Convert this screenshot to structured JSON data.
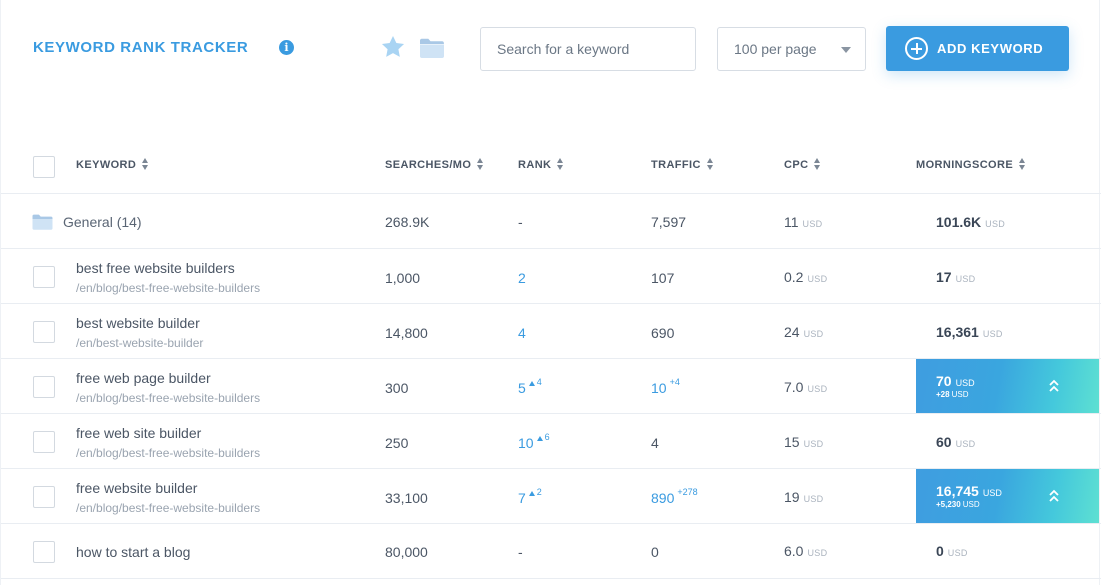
{
  "header": {
    "title": "KEYWORD RANK TRACKER",
    "info_icon": "i",
    "search_placeholder": "Search for a keyword",
    "per_page": "100 per page",
    "add_button": "ADD KEYWORD"
  },
  "columns": {
    "keyword": "KEYWORD",
    "searches": "SEARCHES/MO",
    "rank": "RANK",
    "traffic": "TRAFFIC",
    "cpc": "CPC",
    "morningscore": "MORNINGSCORE"
  },
  "group": {
    "name": "General (14)",
    "searches": "268.9K",
    "rank": "-",
    "traffic": "7,597",
    "cpc": "11",
    "cpc_unit": "USD",
    "score": "101.6K",
    "score_unit": "USD"
  },
  "rows": [
    {
      "keyword": "best free website builders",
      "path": "/en/blog/best-free-website-builders",
      "searches": "1,000",
      "rank": "2",
      "rank_change": "",
      "traffic": "107",
      "traffic_change": "",
      "cpc": "0.2",
      "cpc_unit": "USD",
      "score": "17",
      "score_unit": "USD",
      "score_change": "",
      "highlight": false
    },
    {
      "keyword": "best website builder",
      "path": "/en/best-website-builder",
      "searches": "14,800",
      "rank": "4",
      "rank_change": "",
      "traffic": "690",
      "traffic_change": "",
      "cpc": "24",
      "cpc_unit": "USD",
      "score": "16,361",
      "score_unit": "USD",
      "score_change": "",
      "highlight": false
    },
    {
      "keyword": "free web page builder",
      "path": "/en/blog/best-free-website-builders",
      "searches": "300",
      "rank": "5",
      "rank_change": "4",
      "traffic": "10",
      "traffic_change": "+4",
      "cpc": "7.0",
      "cpc_unit": "USD",
      "score": "70",
      "score_unit": "USD",
      "score_change": "+28",
      "highlight": true
    },
    {
      "keyword": "free web site builder",
      "path": "/en/blog/best-free-website-builders",
      "searches": "250",
      "rank": "10",
      "rank_change": "6",
      "traffic": "4",
      "traffic_change": "",
      "cpc": "15",
      "cpc_unit": "USD",
      "score": "60",
      "score_unit": "USD",
      "score_change": "",
      "highlight": false
    },
    {
      "keyword": "free website builder",
      "path": "/en/blog/best-free-website-builders",
      "searches": "33,100",
      "rank": "7",
      "rank_change": "2",
      "traffic": "890",
      "traffic_change": "+278",
      "cpc": "19",
      "cpc_unit": "USD",
      "score": "16,745",
      "score_unit": "USD",
      "score_change": "+5,230",
      "highlight": true
    },
    {
      "keyword": "how to start a blog",
      "path": "",
      "searches": "80,000",
      "rank": "-",
      "rank_change": "",
      "traffic": "0",
      "traffic_change": "",
      "cpc": "6.0",
      "cpc_unit": "USD",
      "score": "0",
      "score_unit": "USD",
      "score_change": "",
      "highlight": false
    }
  ],
  "colors": {
    "accent": "#3a9be0",
    "gradient_end": "#5ee0d2",
    "text": "#4b5665",
    "muted": "#9aa4b0"
  }
}
